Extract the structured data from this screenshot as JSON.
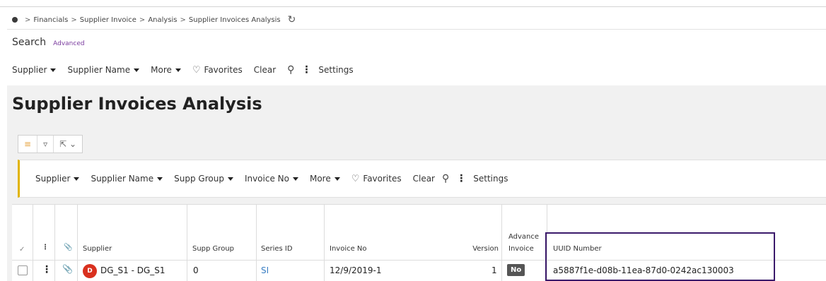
{
  "breadcrumb": {
    "items": [
      "Financials",
      "Supplier Invoice",
      "Analysis",
      "Supplier Invoices Analysis"
    ],
    "separator": ">"
  },
  "search": {
    "title": "Search",
    "advanced_label": "Advanced",
    "filters": {
      "supplier": "Supplier",
      "supplier_name": "Supplier Name",
      "more": "More",
      "favorites": "Favorites",
      "clear": "Clear",
      "settings": "Settings"
    }
  },
  "page": {
    "title": "Supplier Invoices Analysis"
  },
  "table_filters": {
    "supplier": "Supplier",
    "supplier_name": "Supplier Name",
    "supp_group": "Supp Group",
    "invoice_no": "Invoice No",
    "more": "More",
    "favorites": "Favorites",
    "clear": "Clear",
    "settings": "Settings"
  },
  "table": {
    "headers": {
      "supplier": "Supplier",
      "supp_group": "Supp Group",
      "series_id": "Series ID",
      "invoice_no": "Invoice No",
      "version": "Version",
      "advance_invoice_1": "Advance",
      "advance_invoice_2": "Invoice",
      "uuid_number": "UUID Number"
    },
    "rows": [
      {
        "avatar": "D",
        "supplier": "DG_S1 - DG_S1",
        "supp_group": "0",
        "series_id": "SI",
        "invoice_no": "12/9/2019-1",
        "version": "1",
        "advance_invoice": "No",
        "uuid_number": "a5887f1e-d08b-11ea-87d0-0242ac130003"
      }
    ]
  },
  "colors": {
    "highlight_border": "#3b1a6b",
    "accent_bar": "#e1b400",
    "avatar": "#d9301e",
    "link": "#3b7fc4"
  }
}
